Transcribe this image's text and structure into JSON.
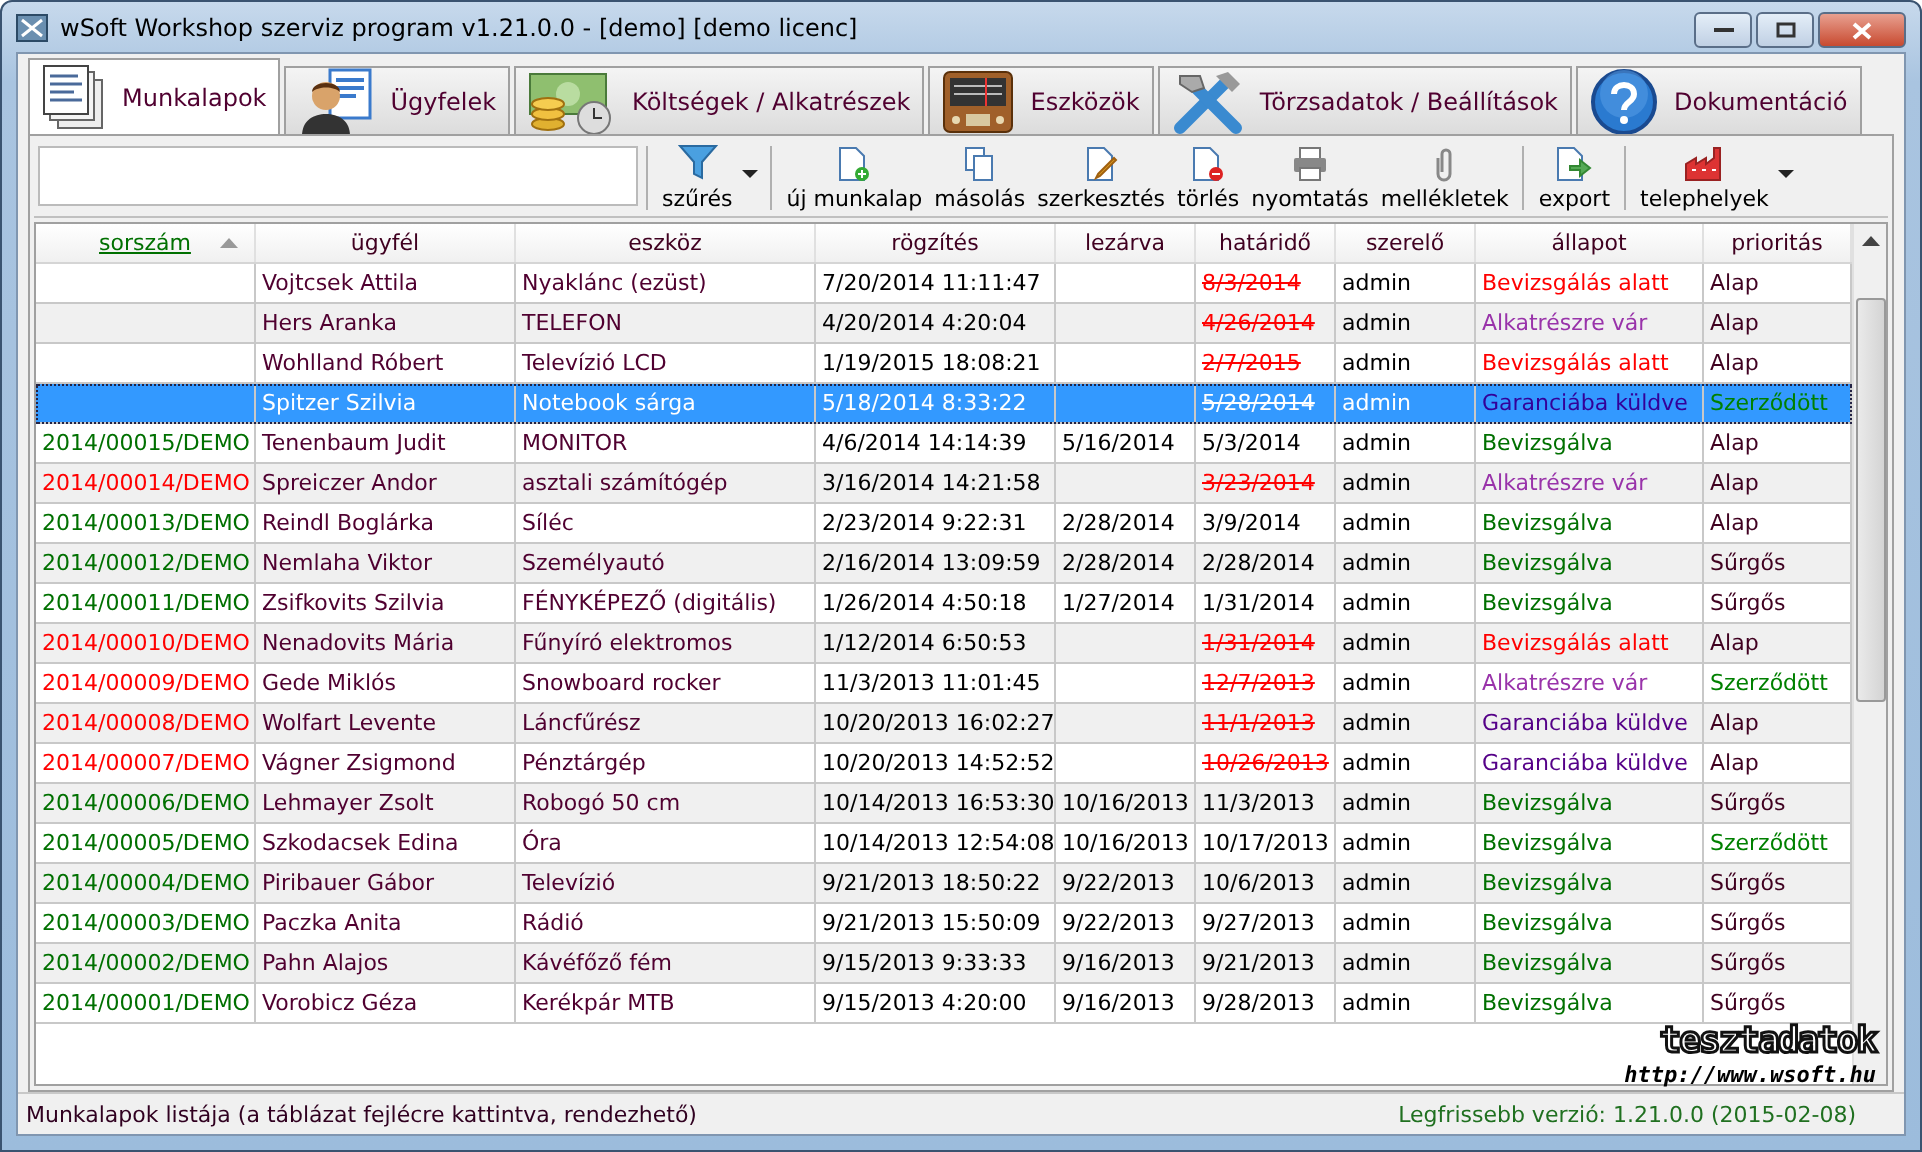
{
  "window": {
    "title": "wSoft Workshop szerviz program v1.21.0.0 - [demo] [demo licenc]"
  },
  "tabs": [
    {
      "label": "Munkalapok",
      "kind": "sheets",
      "selected": true
    },
    {
      "label": "Ügyfelek",
      "kind": "person",
      "selected": false
    },
    {
      "label": "Költségek / Alkatrészek",
      "kind": "money",
      "selected": false
    },
    {
      "label": "Eszközök",
      "kind": "radio",
      "selected": false
    },
    {
      "label": "Törzsadatok / Beállítások",
      "kind": "tools",
      "selected": false
    },
    {
      "label": "Dokumentáció",
      "kind": "help",
      "selected": false
    }
  ],
  "toolbar": [
    [
      {
        "label": "szűrés",
        "kind": "filter",
        "dropdown": true
      }
    ],
    [
      {
        "label": "új munkalap",
        "kind": "new",
        "dropdown": false
      },
      {
        "label": "másolás",
        "kind": "copy",
        "dropdown": false
      },
      {
        "label": "szerkesztés",
        "kind": "edit",
        "dropdown": false
      },
      {
        "label": "törlés",
        "kind": "delete",
        "dropdown": false
      },
      {
        "label": "nyomtatás",
        "kind": "print",
        "dropdown": false
      },
      {
        "label": "mellékletek",
        "kind": "clip",
        "dropdown": false
      }
    ],
    [
      {
        "label": "export",
        "kind": "export",
        "dropdown": false
      }
    ],
    [
      {
        "label": "telephelyek",
        "kind": "factory",
        "dropdown": true
      }
    ]
  ],
  "table": {
    "columns": [
      {
        "label": "sorszám",
        "sorted": true
      },
      {
        "label": "ügyfél",
        "sorted": false
      },
      {
        "label": "eszköz",
        "sorted": false
      },
      {
        "label": "rögzítés",
        "sorted": false
      },
      {
        "label": "lezárva",
        "sorted": false
      },
      {
        "label": "határidő",
        "sorted": false
      },
      {
        "label": "szerelő",
        "sorted": false
      },
      {
        "label": "állapot",
        "sorted": false
      },
      {
        "label": "prioritás",
        "sorted": false
      }
    ],
    "rows": [
      {
        "selected": false,
        "id": null,
        "customer": "Vojtcsek Attila",
        "device": "Nyaklánc (ezüst)",
        "recorded": "7/20/2014 11:11:47",
        "closed": "",
        "deadline": "8/3/2014",
        "overdue": true,
        "mechanic": "admin",
        "status": {
          "text": "Bevizsgálás alatt",
          "color": "#ff0000"
        },
        "priority": {
          "text": "Alap",
          "color": "#400020"
        }
      },
      {
        "selected": false,
        "id": null,
        "customer": "Hers Aranka",
        "device": "TELEFON",
        "recorded": "4/20/2014 4:20:04",
        "closed": "",
        "deadline": "4/26/2014",
        "overdue": true,
        "mechanic": "admin",
        "status": {
          "text": "Alkatrészre vár",
          "color": "#9933aa"
        },
        "priority": {
          "text": "Alap",
          "color": "#400020"
        }
      },
      {
        "selected": false,
        "id": null,
        "customer": "Wohlland Róbert",
        "device": "Televízió LCD",
        "recorded": "1/19/2015 18:08:21",
        "closed": "",
        "deadline": "2/7/2015",
        "overdue": true,
        "mechanic": "admin",
        "status": {
          "text": "Bevizsgálás alatt",
          "color": "#ff0000"
        },
        "priority": {
          "text": "Alap",
          "color": "#400020"
        }
      },
      {
        "selected": true,
        "id": null,
        "customer": "Spitzer Szilvia",
        "device": "Notebook sárga",
        "recorded": "5/18/2014 8:33:22",
        "closed": "",
        "deadline": "5/28/2014",
        "overdue": true,
        "mechanic": "admin",
        "status": {
          "text": "Garanciába küldve",
          "color": "#330099"
        },
        "priority": {
          "text": "Szerződött",
          "color": "#008000"
        }
      },
      {
        "selected": false,
        "id": {
          "text": "2014/00015/DEMO",
          "color": "#007000"
        },
        "customer": "Tenenbaum Judit",
        "device": "MONITOR",
        "recorded": "4/6/2014 14:14:39",
        "closed": "5/16/2014",
        "deadline": "5/3/2014",
        "overdue": false,
        "mechanic": "admin",
        "status": {
          "text": "Bevizsgálva",
          "color": "#007000"
        },
        "priority": {
          "text": "Alap",
          "color": "#400020"
        }
      },
      {
        "selected": false,
        "id": {
          "text": "2014/00014/DEMO",
          "color": "#ff0000"
        },
        "customer": "Spreiczer Andor",
        "device": "asztali számítógép",
        "recorded": "3/16/2014 14:21:58",
        "closed": "",
        "deadline": "3/23/2014",
        "overdue": true,
        "mechanic": "admin",
        "status": {
          "text": "Alkatrészre vár",
          "color": "#9933aa"
        },
        "priority": {
          "text": "Alap",
          "color": "#400020"
        }
      },
      {
        "selected": false,
        "id": {
          "text": "2014/00013/DEMO",
          "color": "#007000"
        },
        "customer": "Reindl Boglárka",
        "device": "Síléc",
        "recorded": "2/23/2014 9:22:31",
        "closed": "2/28/2014",
        "deadline": "3/9/2014",
        "overdue": false,
        "mechanic": "admin",
        "status": {
          "text": "Bevizsgálva",
          "color": "#007000"
        },
        "priority": {
          "text": "Alap",
          "color": "#400020"
        }
      },
      {
        "selected": false,
        "id": {
          "text": "2014/00012/DEMO",
          "color": "#007000"
        },
        "customer": "Nemlaha Viktor",
        "device": "Személyautó",
        "recorded": "2/16/2014 13:09:59",
        "closed": "2/28/2014",
        "deadline": "2/28/2014",
        "overdue": false,
        "mechanic": "admin",
        "status": {
          "text": "Bevizsgálva",
          "color": "#007000"
        },
        "priority": {
          "text": "Sűrgős",
          "color": "#400020"
        }
      },
      {
        "selected": false,
        "id": {
          "text": "2014/00011/DEMO",
          "color": "#007000"
        },
        "customer": "Zsifkovits Szilvia",
        "device": "FÉNYKÉPEZŐ (digitális)",
        "recorded": "1/26/2014 4:50:18",
        "closed": "1/27/2014",
        "deadline": "1/31/2014",
        "overdue": false,
        "mechanic": "admin",
        "status": {
          "text": "Bevizsgálva",
          "color": "#007000"
        },
        "priority": {
          "text": "Sűrgős",
          "color": "#400020"
        }
      },
      {
        "selected": false,
        "id": {
          "text": "2014/00010/DEMO",
          "color": "#ff0000"
        },
        "customer": "Nenadovits Mária",
        "device": "Fűnyíró elektromos",
        "recorded": "1/12/2014 6:50:53",
        "closed": "",
        "deadline": "1/31/2014",
        "overdue": true,
        "mechanic": "admin",
        "status": {
          "text": "Bevizsgálás alatt",
          "color": "#ff0000"
        },
        "priority": {
          "text": "Alap",
          "color": "#400020"
        }
      },
      {
        "selected": false,
        "id": {
          "text": "2014/00009/DEMO",
          "color": "#ff0000"
        },
        "customer": "Gede Miklós",
        "device": "Snowboard rocker",
        "recorded": "11/3/2013 11:01:45",
        "closed": "",
        "deadline": "12/7/2013",
        "overdue": true,
        "mechanic": "admin",
        "status": {
          "text": "Alkatrészre vár",
          "color": "#9933aa"
        },
        "priority": {
          "text": "Szerződött",
          "color": "#008000"
        }
      },
      {
        "selected": false,
        "id": {
          "text": "2014/00008/DEMO",
          "color": "#ff0000"
        },
        "customer": "Wolfart Levente",
        "device": "Láncfűrész",
        "recorded": "10/20/2013 16:02:27",
        "closed": "",
        "deadline": "11/1/2013",
        "overdue": true,
        "mechanic": "admin",
        "status": {
          "text": "Garanciába küldve",
          "color": "#550088"
        },
        "priority": {
          "text": "Alap",
          "color": "#400020"
        }
      },
      {
        "selected": false,
        "id": {
          "text": "2014/00007/DEMO",
          "color": "#ff0000"
        },
        "customer": "Vágner Zsigmond",
        "device": "Pénztárgép",
        "recorded": "10/20/2013 14:52:52",
        "closed": "",
        "deadline": "10/26/2013",
        "overdue": true,
        "mechanic": "admin",
        "status": {
          "text": "Garanciába küldve",
          "color": "#550088"
        },
        "priority": {
          "text": "Alap",
          "color": "#400020"
        }
      },
      {
        "selected": false,
        "id": {
          "text": "2014/00006/DEMO",
          "color": "#007000"
        },
        "customer": "Lehmayer Zsolt",
        "device": "Robogó 50 cm",
        "recorded": "10/14/2013 16:53:30",
        "closed": "10/16/2013",
        "deadline": "11/3/2013",
        "overdue": false,
        "mechanic": "admin",
        "status": {
          "text": "Bevizsgálva",
          "color": "#007000"
        },
        "priority": {
          "text": "Sűrgős",
          "color": "#400020"
        }
      },
      {
        "selected": false,
        "id": {
          "text": "2014/00005/DEMO",
          "color": "#007000"
        },
        "customer": "Szkodacsek Edina",
        "device": "Óra",
        "recorded": "10/14/2013 12:54:08",
        "closed": "10/16/2013",
        "deadline": "10/17/2013",
        "overdue": false,
        "mechanic": "admin",
        "status": {
          "text": "Bevizsgálva",
          "color": "#007000"
        },
        "priority": {
          "text": "Szerződött",
          "color": "#008000"
        }
      },
      {
        "selected": false,
        "id": {
          "text": "2014/00004/DEMO",
          "color": "#007000"
        },
        "customer": "Piribauer Gábor",
        "device": "Televízió",
        "recorded": "9/21/2013 18:50:22",
        "closed": "9/22/2013",
        "deadline": "10/6/2013",
        "overdue": false,
        "mechanic": "admin",
        "status": {
          "text": "Bevizsgálva",
          "color": "#007000"
        },
        "priority": {
          "text": "Sűrgős",
          "color": "#400020"
        }
      },
      {
        "selected": false,
        "id": {
          "text": "2014/00003/DEMO",
          "color": "#007000"
        },
        "customer": "Paczka Anita",
        "device": "Rádió",
        "recorded": "9/21/2013 15:50:09",
        "closed": "9/22/2013",
        "deadline": "9/27/2013",
        "overdue": false,
        "mechanic": "admin",
        "status": {
          "text": "Bevizsgálva",
          "color": "#007000"
        },
        "priority": {
          "text": "Sűrgős",
          "color": "#400020"
        }
      },
      {
        "selected": false,
        "id": {
          "text": "2014/00002/DEMO",
          "color": "#007000"
        },
        "customer": "Pahn Alajos",
        "device": "Kávéfőző fém",
        "recorded": "9/15/2013 9:33:33",
        "closed": "9/16/2013",
        "deadline": "9/21/2013",
        "overdue": false,
        "mechanic": "admin",
        "status": {
          "text": "Bevizsgálva",
          "color": "#007000"
        },
        "priority": {
          "text": "Sűrgős",
          "color": "#400020"
        }
      },
      {
        "selected": false,
        "id": {
          "text": "2014/00001/DEMO",
          "color": "#007000"
        },
        "customer": "Vorobicz Géza",
        "device": "Kerékpár MTB",
        "recorded": "9/15/2013 4:20:00",
        "closed": "9/16/2013",
        "deadline": "9/28/2013",
        "overdue": false,
        "mechanic": "admin",
        "status": {
          "text": "Bevizsgálva",
          "color": "#007000"
        },
        "priority": {
          "text": "Sűrgős",
          "color": "#400020"
        }
      }
    ]
  },
  "overlay": {
    "title": "tesztadatok",
    "url": "http://www.wsoft.hu"
  },
  "status_bar": {
    "message": "Munkalapok listája (a táblázat fejlécre kattintva, rendezhető)",
    "version": "Legfrissebb verzió: 1.21.0.0 (2015-02-08)"
  }
}
